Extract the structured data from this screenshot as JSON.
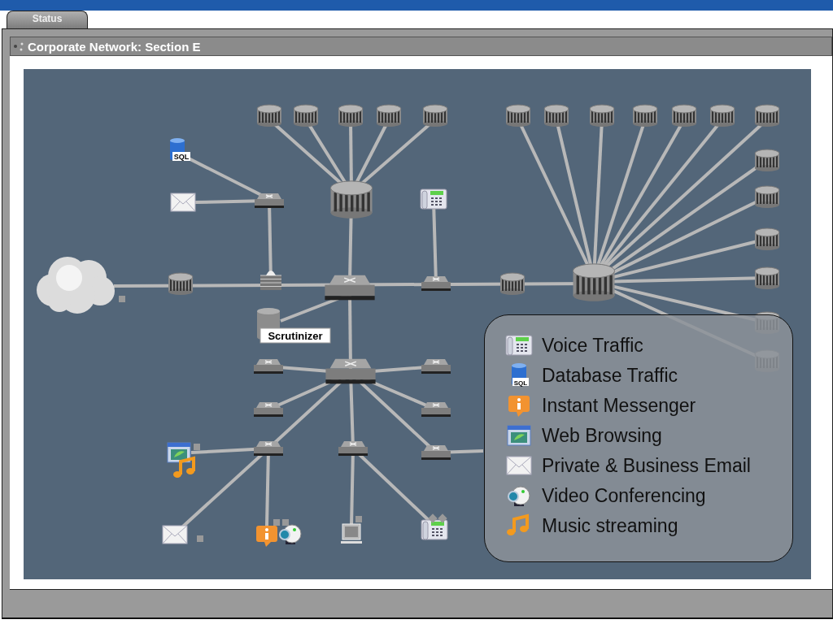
{
  "tabs": [
    {
      "label": "Status",
      "selected": true
    }
  ],
  "panel": {
    "title": "Corporate Network: Section E"
  },
  "diagram": {
    "database_tag": "SQL",
    "collector_label": "Scrutinizer"
  },
  "legend": [
    {
      "kind": "phone",
      "label": "Voice Traffic"
    },
    {
      "kind": "database",
      "label": "Database Traffic",
      "icon_text": "SQL"
    },
    {
      "kind": "messenger",
      "label": "Instant Messenger"
    },
    {
      "kind": "web",
      "label": "Web Browsing"
    },
    {
      "kind": "email",
      "label": "Private & Business Email"
    },
    {
      "kind": "camera",
      "label": "Video Conferencing"
    },
    {
      "kind": "music",
      "label": "Music streaming"
    }
  ]
}
